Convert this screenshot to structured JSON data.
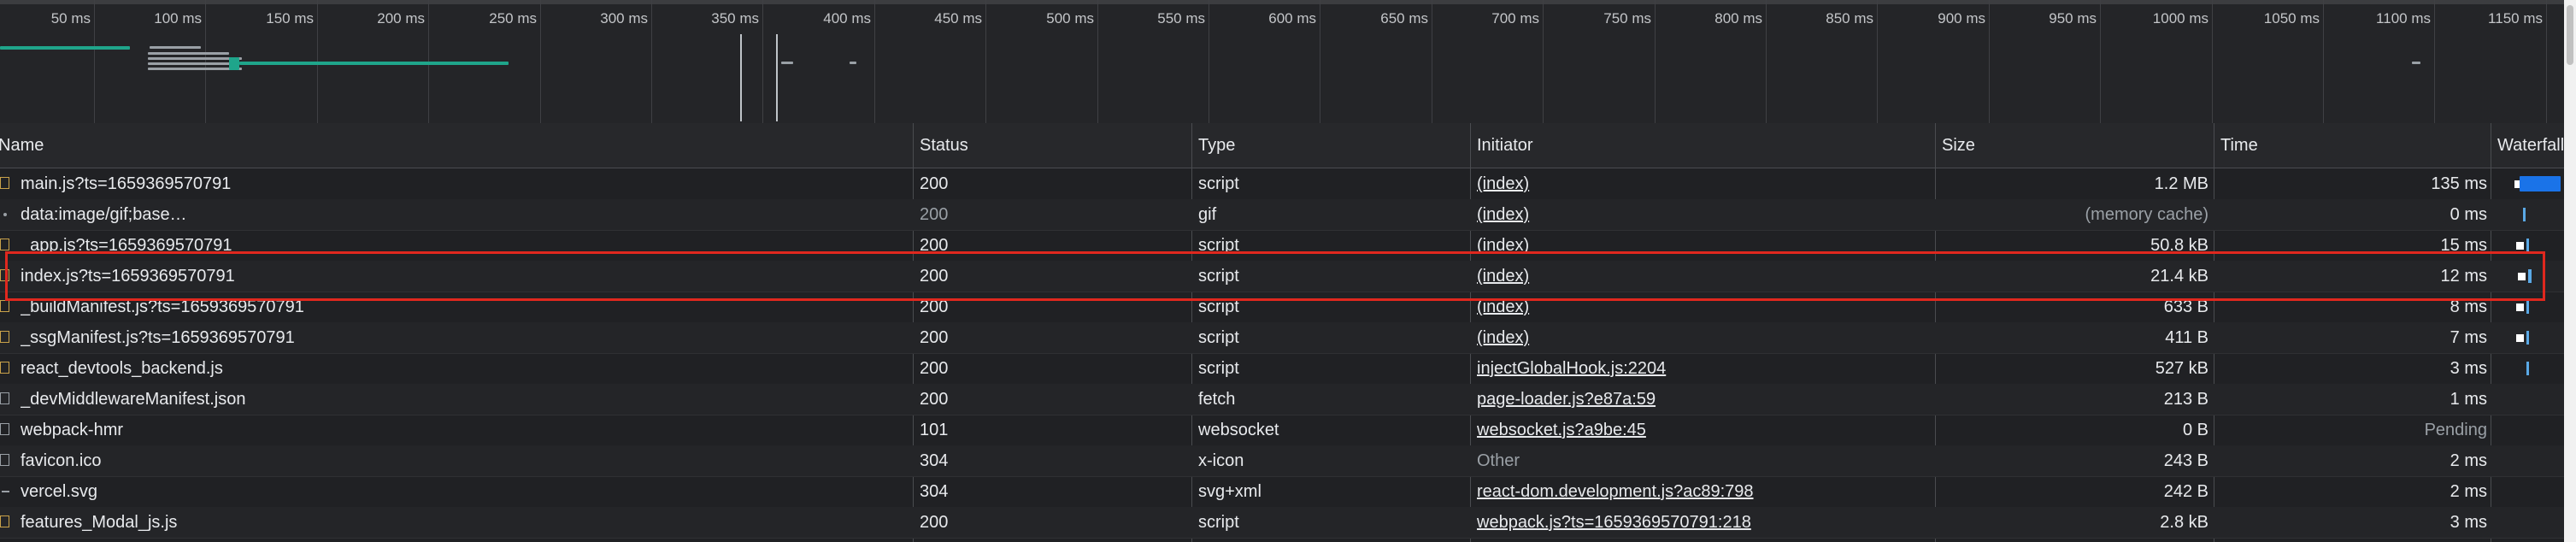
{
  "overview": {
    "ticks": [
      "50 ms",
      "100 ms",
      "150 ms",
      "200 ms",
      "250 ms",
      "300 ms",
      "350 ms",
      "400 ms",
      "450 ms",
      "500 ms",
      "550 ms",
      "600 ms",
      "650 ms",
      "700 ms",
      "750 ms",
      "800 ms",
      "850 ms",
      "900 ms",
      "950 ms",
      "1000 ms",
      "1050 ms",
      "1100 ms",
      "1150 ms"
    ]
  },
  "table": {
    "columns": {
      "name": "Name",
      "status": "Status",
      "type": "Type",
      "initiator": "Initiator",
      "size": "Size",
      "time": "Time",
      "waterfall": "Waterfall"
    },
    "rows": [
      {
        "name": "main.js?ts=1659369570791",
        "status": "200",
        "type": "script",
        "initiator": "(index)",
        "size": "1.2 MB",
        "time": "135 ms",
        "icon": "script-file-icon"
      },
      {
        "name": "data:image/gif;base…",
        "status": "200",
        "type": "gif",
        "initiator": "(index)",
        "size": "(memory cache)",
        "time": "0 ms",
        "icon": "data-uri-icon"
      },
      {
        "name": "_app.js?ts=1659369570791",
        "status": "200",
        "type": "script",
        "initiator": "(index)",
        "size": "50.8 kB",
        "time": "15 ms",
        "icon": "script-file-icon"
      },
      {
        "name": "index.js?ts=1659369570791",
        "status": "200",
        "type": "script",
        "initiator": "(index)",
        "size": "21.4 kB",
        "time": "12 ms",
        "icon": "script-file-icon"
      },
      {
        "name": "_buildManifest.js?ts=1659369570791",
        "status": "200",
        "type": "script",
        "initiator": "(index)",
        "size": "633 B",
        "time": "8 ms",
        "icon": "script-file-icon"
      },
      {
        "name": "_ssgManifest.js?ts=1659369570791",
        "status": "200",
        "type": "script",
        "initiator": "(index)",
        "size": "411 B",
        "time": "7 ms",
        "icon": "script-file-icon"
      },
      {
        "name": "react_devtools_backend.js",
        "status": "200",
        "type": "script",
        "initiator": "injectGlobalHook.js:2204",
        "size": "527 kB",
        "time": "3 ms",
        "icon": "script-file-icon"
      },
      {
        "name": "_devMiddlewareManifest.json",
        "status": "200",
        "type": "fetch",
        "initiator": "page-loader.js?e87a:59",
        "size": "213 B",
        "time": "1 ms",
        "icon": "document-icon"
      },
      {
        "name": "webpack-hmr",
        "status": "101",
        "type": "websocket",
        "initiator": "websocket.js?a9be:45",
        "size": "0 B",
        "time": "Pending",
        "icon": "document-icon"
      },
      {
        "name": "favicon.ico",
        "status": "304",
        "type": "x-icon",
        "initiator": "Other",
        "size": "243 B",
        "time": "2 ms",
        "icon": "document-icon"
      },
      {
        "name": "vercel.svg",
        "status": "304",
        "type": "svg+xml",
        "initiator": "react-dom.development.js?ac89:798",
        "size": "242 B",
        "time": "2 ms",
        "icon": "image-icon"
      },
      {
        "name": "features_Modal_js.js",
        "status": "200",
        "type": "script",
        "initiator": "webpack.js?ts=1659369570791:218",
        "size": "2.8 kB",
        "time": "3 ms",
        "icon": "script-file-icon"
      }
    ]
  }
}
